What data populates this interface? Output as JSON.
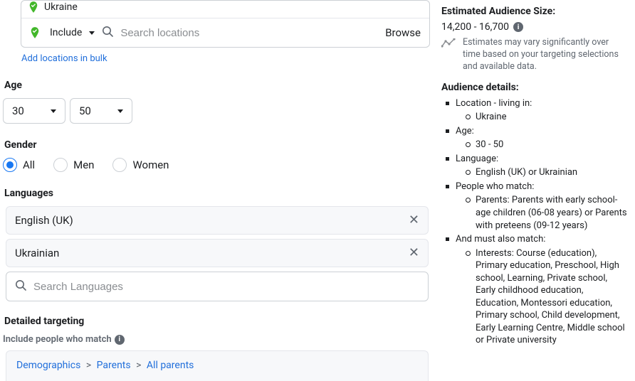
{
  "location": {
    "chip": "Ukraine",
    "include_label": "Include",
    "search_placeholder": "Search locations",
    "browse_label": "Browse",
    "bulk_link": "Add locations in bulk"
  },
  "age": {
    "title": "Age",
    "min": "30",
    "max": "50"
  },
  "gender": {
    "title": "Gender",
    "options": {
      "all": "All",
      "men": "Men",
      "women": "Women"
    },
    "selected": "all"
  },
  "languages": {
    "title": "Languages",
    "items": [
      "English (UK)",
      "Ukrainian"
    ],
    "search_placeholder": "Search Languages"
  },
  "detailed": {
    "title": "Detailed targeting",
    "subtitle": "Include people who match",
    "crumb": [
      "Demographics",
      "Parents",
      "All parents"
    ]
  },
  "side": {
    "size_title": "Estimated Audience Size:",
    "size_range": "14,200 - 16,700",
    "note": "Estimates may vary significantly over time based on your targeting selections and available data.",
    "details_title": "Audience details:",
    "items": [
      {
        "label": "Location - living in:",
        "sub": [
          "Ukraine"
        ]
      },
      {
        "label": "Age:",
        "sub": [
          "30 - 50"
        ]
      },
      {
        "label": "Language:",
        "sub": [
          "English (UK) or Ukrainian"
        ]
      },
      {
        "label": "People who match:",
        "sub": [
          "Parents: Parents with early school-age children (06-08 years) or Parents with preteens (09-12 years)"
        ]
      },
      {
        "label": "And must also match:",
        "sub": [
          "Interests: Course (education), Primary education, Preschool, High school, Learning, Private school, Early childhood education, Education, Montessori education, Primary school, Child development, Early Learning Centre, Middle school or Private university"
        ]
      }
    ]
  }
}
